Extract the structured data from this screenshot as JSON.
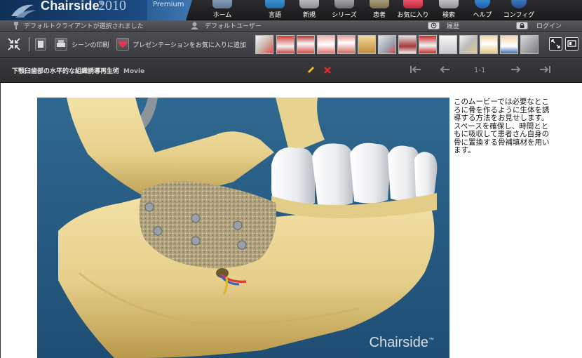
{
  "app": {
    "brand": "Chairside",
    "trademark": "®",
    "year": "2010",
    "edition": "Premium"
  },
  "nav": [
    {
      "label": "ホーム",
      "icon": "home-icon"
    },
    {
      "label": "言語",
      "icon": "language-icon"
    },
    {
      "label": "新規",
      "icon": "new-icon"
    },
    {
      "label": "シリーズ",
      "icon": "series-icon"
    },
    {
      "label": "患者",
      "icon": "patient-icon"
    },
    {
      "label": "お気に入り",
      "icon": "favorites-icon"
    },
    {
      "label": "検索",
      "icon": "search-icon"
    },
    {
      "label": "ヘルプ",
      "icon": "help-icon"
    },
    {
      "label": "コンフィグ",
      "icon": "config-icon"
    }
  ],
  "status": {
    "client": "デフォルトクライアントが選択されました",
    "user": "デフォルトユーザー",
    "history": "履歴",
    "login": "ログイン"
  },
  "toolbar": {
    "print_label": "シーンの印刷",
    "favorite_label": "プレゼンテーションをお気に入りに追加",
    "thumbnails": [
      "instrument",
      "red-gum",
      "teeth-row",
      "smile",
      "gum-lift",
      "roots",
      "tools",
      "bridge",
      "red-crowns",
      "white-teeth",
      "clamp",
      "nerve",
      "hand",
      "instrument-tray"
    ]
  },
  "title": {
    "text": "下顎臼歯部の水平的な組織誘導再生術",
    "type": "Movie",
    "pager": "1-1"
  },
  "content": {
    "description": "このムービーでは必要なところに骨を作るように生体を誘導する方法をお見せします。スペースを確保し、時間とともに吸収して患者さん自身の骨に置換する骨補填材を用います。",
    "watermark": "Chairside",
    "watermark_tm": "™"
  },
  "colors": {
    "bone": "#ecd89a",
    "bone_shadow": "#b99a4c",
    "background_blue": "#2a5f86",
    "graft": "#a99c77",
    "accent_red": "#e03a2e"
  }
}
